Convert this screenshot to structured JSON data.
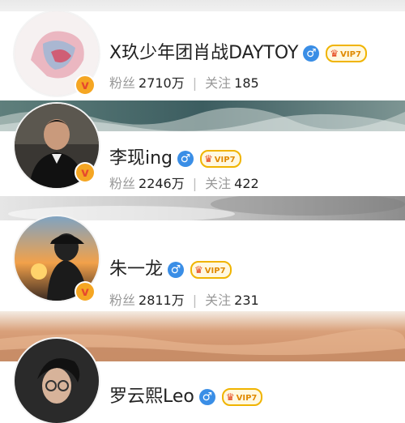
{
  "users": [
    {
      "name": "X玖少年团肖战DAYTOY",
      "gender_symbol": "♂",
      "vip_label": "VIP7",
      "fans_label": "粉丝",
      "fans_value": "2710万",
      "follow_label": "关注",
      "follow_value": "185"
    },
    {
      "name": "李现ing",
      "gender_symbol": "♂",
      "vip_label": "VIP7",
      "fans_label": "粉丝",
      "fans_value": "2246万",
      "follow_label": "关注",
      "follow_value": "422"
    },
    {
      "name": "朱一龙",
      "gender_symbol": "♂",
      "vip_label": "VIP7",
      "fans_label": "粉丝",
      "fans_value": "2811万",
      "follow_label": "关注",
      "follow_value": "231"
    },
    {
      "name": "罗云熙Leo",
      "gender_symbol": "♂",
      "vip_label": "VIP7"
    }
  ],
  "badge_letter": "v",
  "stat_separator": "|",
  "colors": {
    "gender": "#3a8ee6",
    "vip_border": "#f0b400",
    "badge": "#f5a623"
  }
}
